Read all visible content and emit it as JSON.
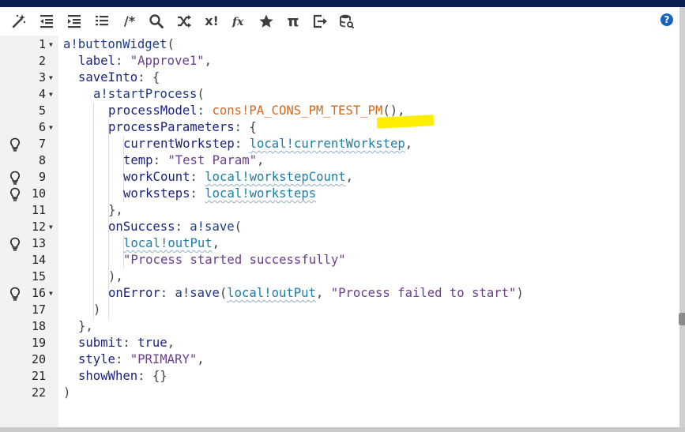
{
  "toolbar": {
    "buttons": [
      {
        "name": "magic-wand",
        "label": ""
      },
      {
        "name": "outdent",
        "label": ""
      },
      {
        "name": "indent",
        "label": ""
      },
      {
        "name": "list-format",
        "label": ""
      },
      {
        "name": "comment",
        "label": "/*"
      },
      {
        "name": "search",
        "label": ""
      },
      {
        "name": "shuffle",
        "label": ""
      },
      {
        "name": "variables",
        "label": "x!"
      },
      {
        "name": "function",
        "label": "fx"
      },
      {
        "name": "star",
        "label": ""
      },
      {
        "name": "pi",
        "label": "π"
      },
      {
        "name": "export",
        "label": ""
      },
      {
        "name": "database",
        "label": ""
      }
    ],
    "help_label": "?"
  },
  "line_numbers": [
    "1",
    "2",
    "3",
    "4",
    "5",
    "6",
    "7",
    "8",
    "9",
    "10",
    "11",
    "12",
    "13",
    "14",
    "15",
    "16",
    "17",
    "18",
    "19",
    "20",
    "21",
    "22"
  ],
  "code": {
    "l1": {
      "fn": "a!buttonWidget",
      "open": "("
    },
    "l2": {
      "key": "label",
      "colon": ": ",
      "str": "\"Approve1\"",
      "comma": ","
    },
    "l3": {
      "key": "saveInto",
      "colon": ": ",
      "open": "{"
    },
    "l4": {
      "fn": "a!startProcess",
      "open": "("
    },
    "l5": {
      "key": "processModel",
      "colon": ": ",
      "cons": "cons!PA_CONS_PM_TEST_PM",
      "close": "(),"
    },
    "l6": {
      "key": "processParameters",
      "colon": ": ",
      "open": "{"
    },
    "l7": {
      "key": "currentWorkstep",
      "colon": ": ",
      "local": "local!currentWorkstep",
      "comma": ","
    },
    "l8": {
      "key": "temp",
      "colon": ": ",
      "str": "\"Test Param\"",
      "comma": ","
    },
    "l9": {
      "key": "workCount",
      "colon": ": ",
      "local": "local!workstepCount",
      "comma": ","
    },
    "l10": {
      "key": "worksteps",
      "colon": ": ",
      "local": "local!worksteps"
    },
    "l11": {
      "text": "},"
    },
    "l12": {
      "key": "onSuccess",
      "colon": ": ",
      "fn": "a!save",
      "open": "("
    },
    "l13": {
      "local": "local!outPut",
      "comma": ","
    },
    "l14": {
      "str": "\"Process started successfully\""
    },
    "l15": {
      "text": "),"
    },
    "l16": {
      "key": "onError",
      "colon": ": ",
      "fn": "a!save",
      "open": "(",
      "local": "local!outPut",
      "sep": ", ",
      "str": "\"Process failed to start\"",
      "close": ")"
    },
    "l17": {
      "text": ")"
    },
    "l18": {
      "text": "},"
    },
    "l19": {
      "key": "submit",
      "colon": ": ",
      "bool": "true",
      "comma": ","
    },
    "l20": {
      "key": "style",
      "colon": ": ",
      "str": "\"PRIMARY\"",
      "comma": ","
    },
    "l21": {
      "key": "showWhen",
      "colon": ": ",
      "text": "{}"
    },
    "l22": {
      "text": ")"
    }
  },
  "colors": {
    "top_bar": "#0a1f4d",
    "help_button": "#1565c0",
    "constant": "#d2691e",
    "local_variable": "#1b7ea8",
    "string": "#6a3d8f",
    "highlight_marker": "#ffee00"
  }
}
